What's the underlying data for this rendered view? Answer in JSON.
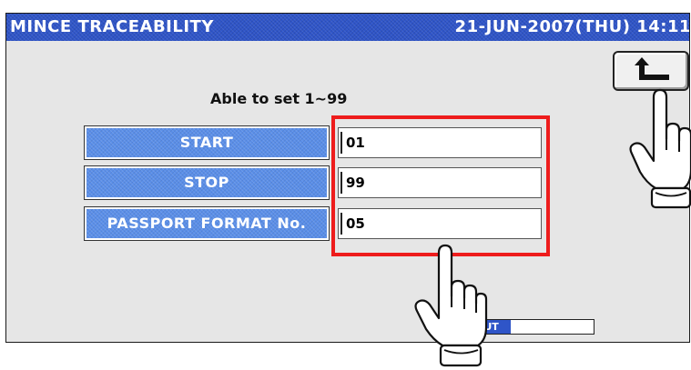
{
  "header": {
    "title": "MINCE TRACEABILITY",
    "datetime": "21-JUN-2007(THU) 14:11"
  },
  "hint": "Able to set 1~99",
  "rows": [
    {
      "label": "START",
      "value": "01"
    },
    {
      "label": "STOP",
      "value": "99"
    },
    {
      "label": "PASSPORT FORMAT No.",
      "value": "05"
    }
  ],
  "output_bar": {
    "label": "OUT",
    "progress": 0.32
  },
  "icons": {
    "back": "return-arrow-icon",
    "hand": "pointing-hand-icon"
  },
  "colors": {
    "title_bar": "#2f55c8",
    "label_button": "#5a8ee8",
    "highlight": "#ee1c1c"
  }
}
